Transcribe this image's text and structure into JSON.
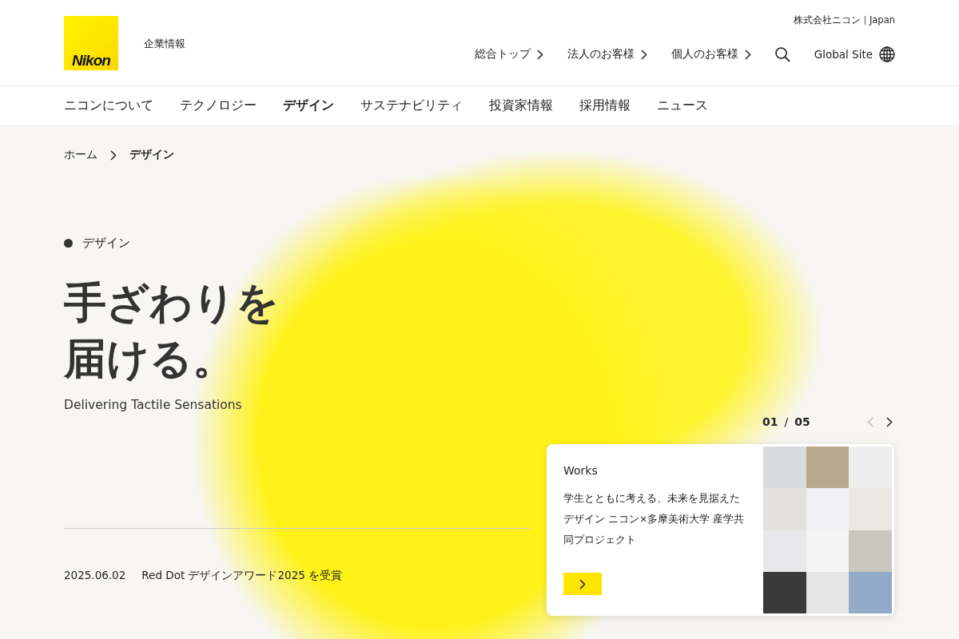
{
  "header": {
    "logo_text": "Nikon",
    "site_label": "企業情報",
    "corporate_link": "株式会社ニコン",
    "region_link": "Japan",
    "nav_links": [
      {
        "label": "総合トップ"
      },
      {
        "label": "法人のお客様"
      },
      {
        "label": "個人のお客様"
      }
    ],
    "global_site": "Global Site"
  },
  "main_nav": [
    {
      "label": "ニコンについて",
      "selected": false
    },
    {
      "label": "テクノロジー",
      "selected": false
    },
    {
      "label": "デザイン",
      "selected": true
    },
    {
      "label": "サステナビリティ",
      "selected": false
    },
    {
      "label": "投資家情報",
      "selected": false
    },
    {
      "label": "採用情報",
      "selected": false
    },
    {
      "label": "ニュース",
      "selected": false
    }
  ],
  "breadcrumb": [
    "ホーム",
    "デザイン"
  ],
  "hero": {
    "category": "デザイン",
    "title_lines": [
      "手ざわりを",
      "届ける。"
    ],
    "subtitle": "Delivering Tactile Sensations"
  },
  "news": [
    {
      "date": "2025.06.02",
      "title": "Red Dot デザインアワード2025 を受賞"
    }
  ],
  "carousel": {
    "current": "01",
    "separator": "/",
    "total": "05",
    "arrows": [
      {
        "kind": "prev",
        "disabled": true
      },
      {
        "kind": "next",
        "disabled": false
      }
    ],
    "card": {
      "label": "Works",
      "title": "学生とともに考える、未来を見据えたデザイン ニコン×多摩美術大学 産学共同プロジェクト"
    }
  }
}
